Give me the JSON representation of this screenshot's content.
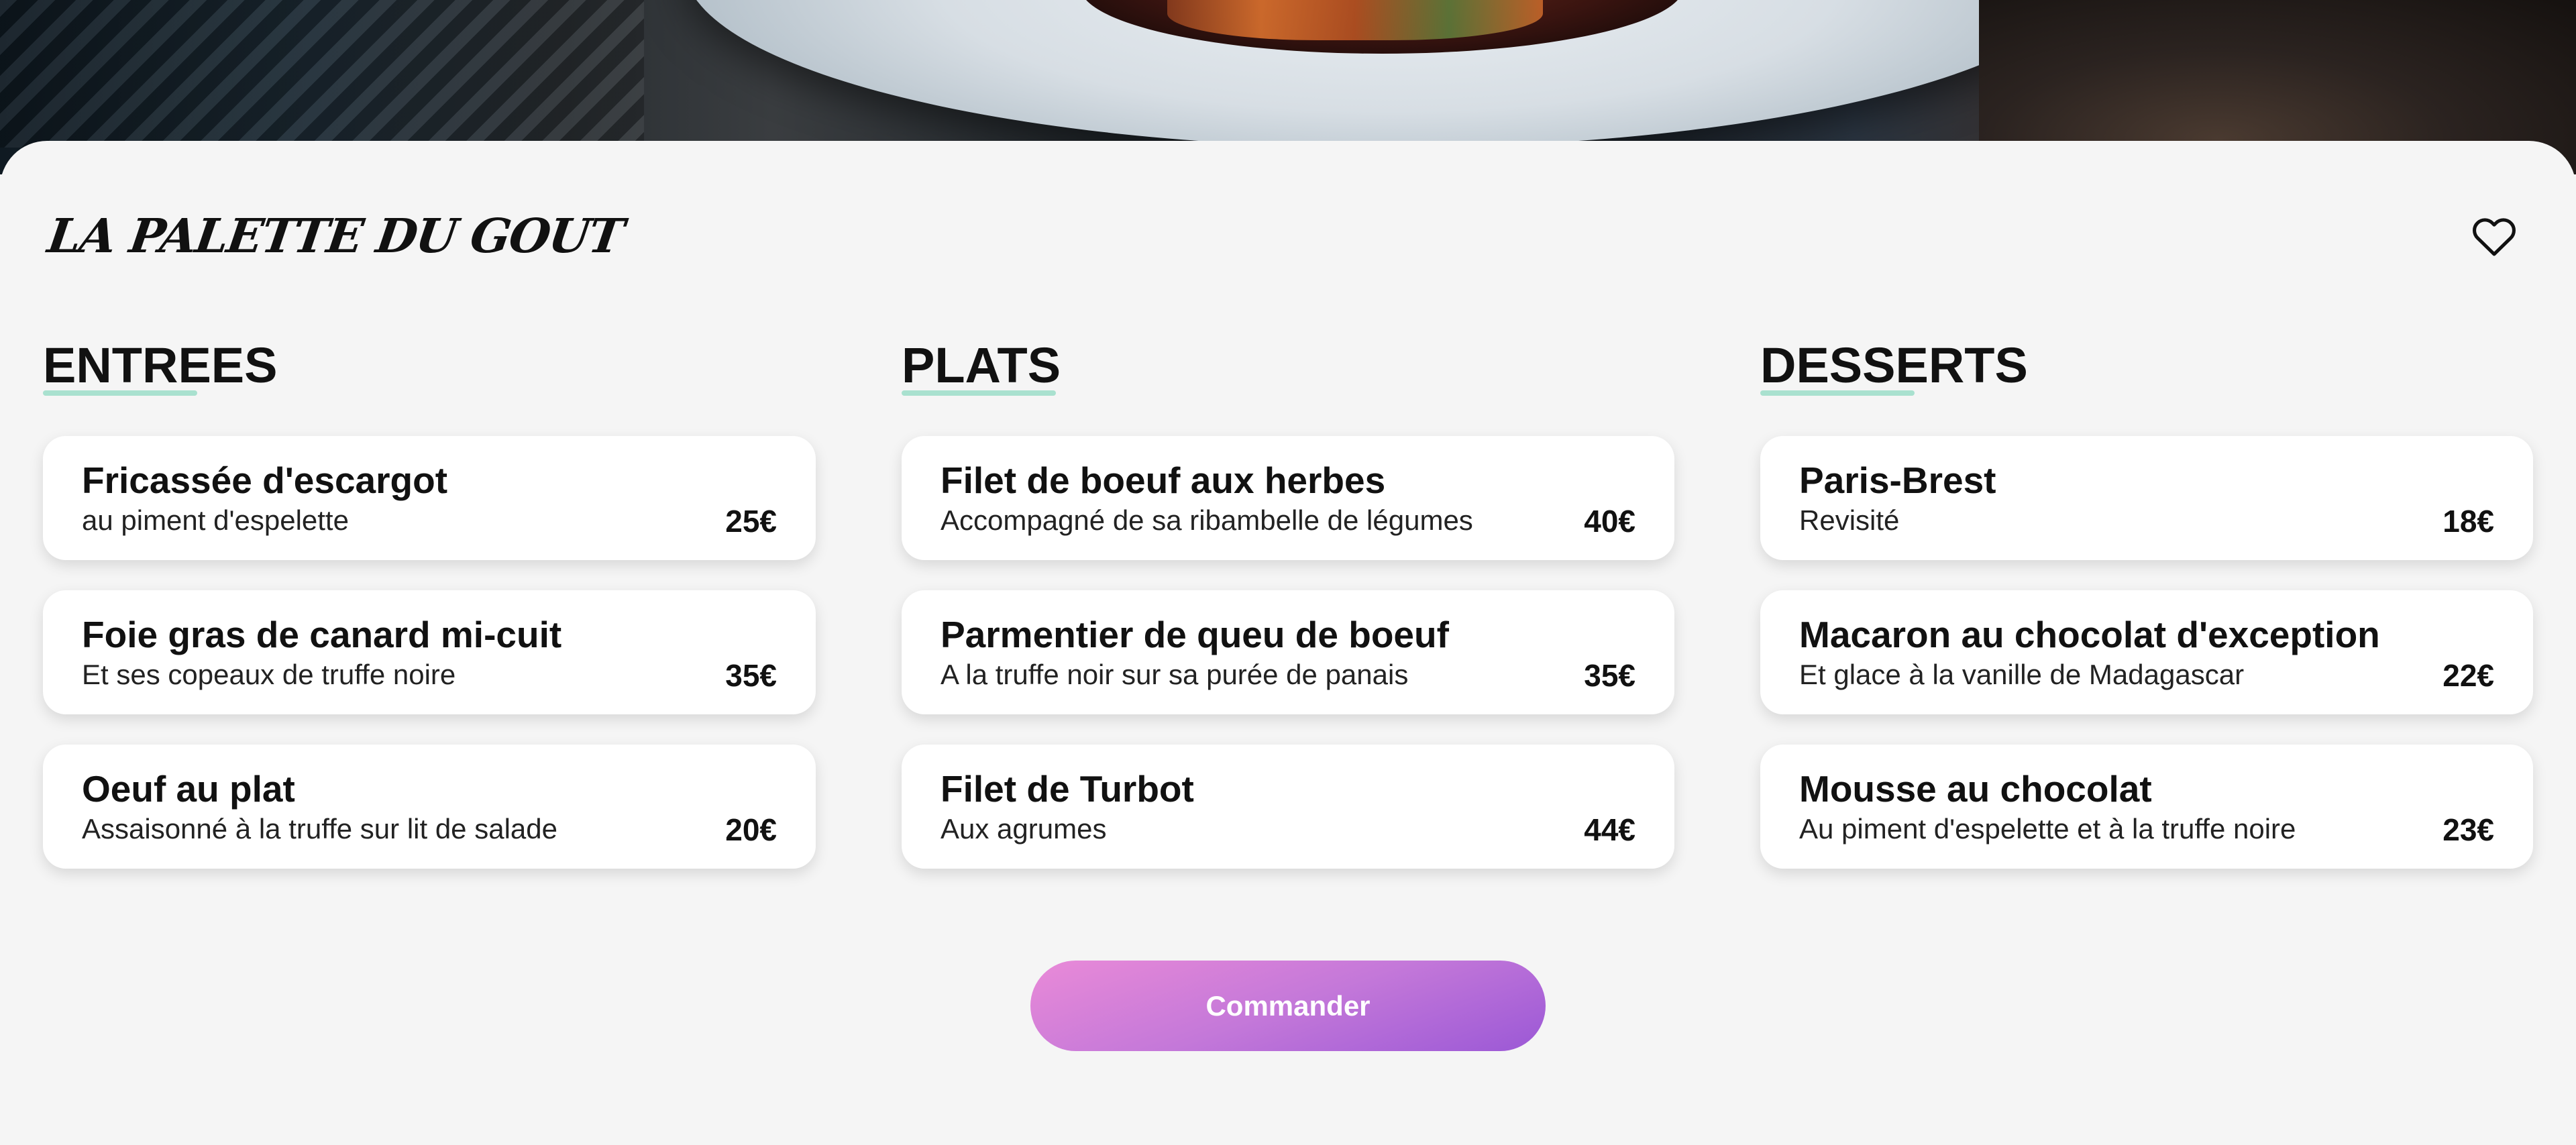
{
  "brand": "LA PALETTE DU GOUT",
  "colors": {
    "background": "#f5f5f5",
    "accent_underline": "#a9e1cf",
    "button_gradient_start": "#e98ad8",
    "button_gradient_end": "#9b58d6"
  },
  "icons": {
    "favorite": "heart-outline-icon"
  },
  "sections": [
    {
      "title": "ENTREES",
      "items": [
        {
          "name": "Fricassée d'escargot",
          "description": "au piment d'espelette",
          "price": "25€"
        },
        {
          "name": "Foie gras de canard mi-cuit",
          "description": "Et ses copeaux de truffe noire",
          "price": "35€"
        },
        {
          "name": "Oeuf au plat",
          "description": "Assaisonné à la truffe sur lit de salade",
          "price": "20€"
        }
      ]
    },
    {
      "title": "PLATS",
      "items": [
        {
          "name": "Filet de boeuf aux herbes",
          "description": "Accompagné de sa ribambelle de légumes",
          "price": "40€"
        },
        {
          "name": "Parmentier de queu de boeuf",
          "description": "A la truffe noir sur sa purée de panais",
          "price": "35€"
        },
        {
          "name": "Filet de Turbot",
          "description": "Aux agrumes",
          "price": "44€"
        }
      ]
    },
    {
      "title": "DESSERTS",
      "items": [
        {
          "name": "Paris-Brest",
          "description": "Revisité",
          "price": "18€"
        },
        {
          "name": "Macaron au chocolat d'exception",
          "description": "Et glace à la vanille de Madagascar",
          "price": "22€"
        },
        {
          "name": "Mousse au chocolat",
          "description": "Au piment d'espelette et à la truffe noire",
          "price": "23€"
        }
      ]
    }
  ],
  "order_button": "Commander"
}
